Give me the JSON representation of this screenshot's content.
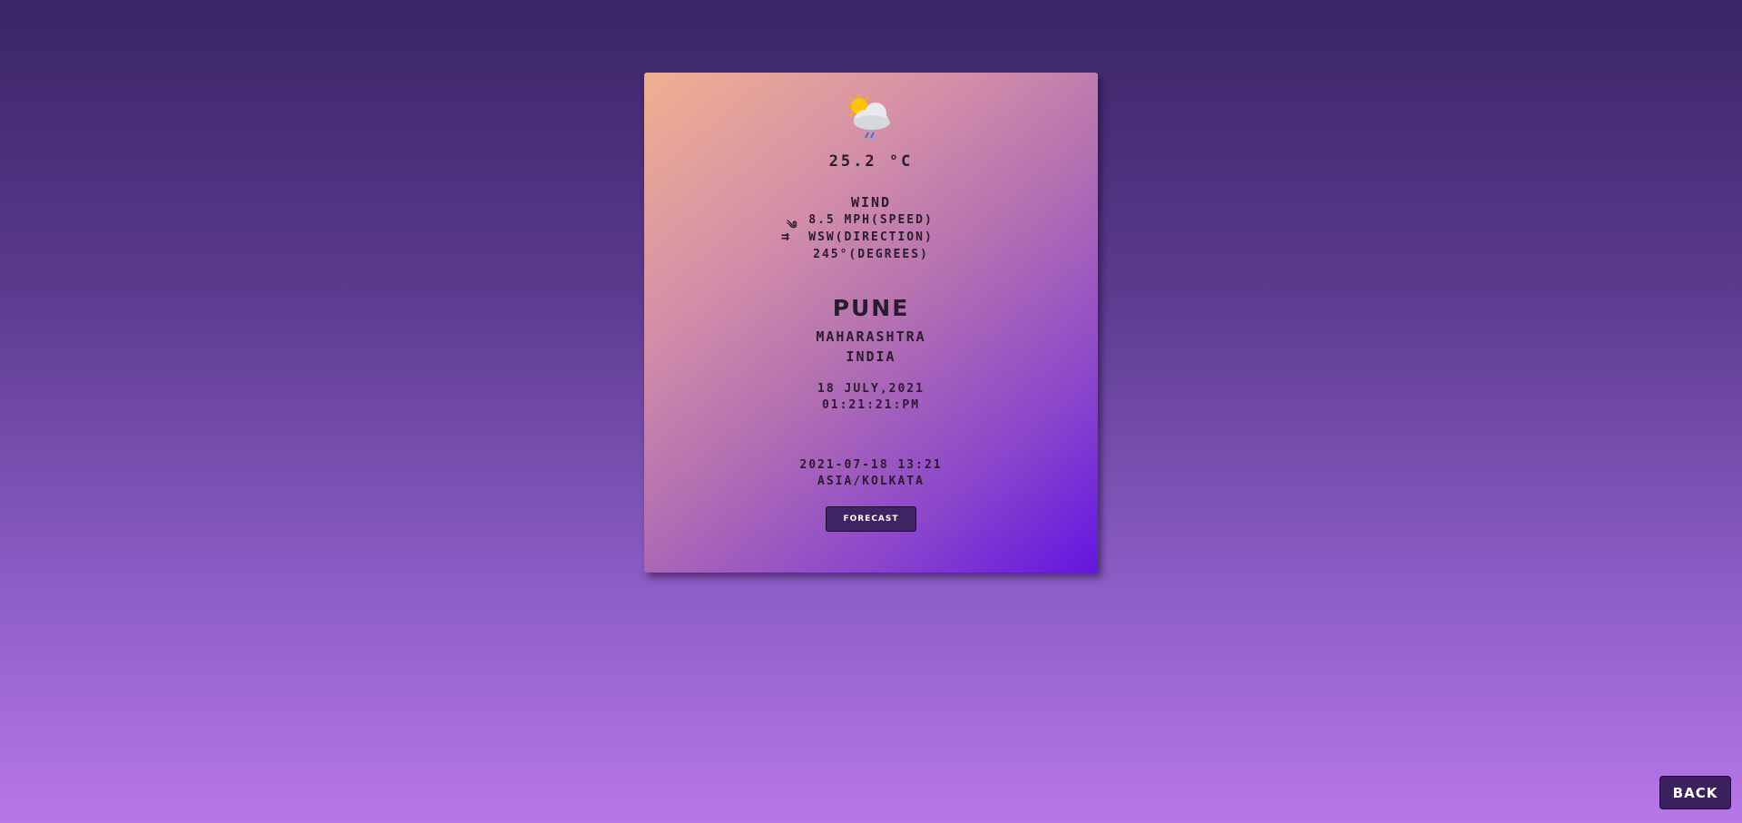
{
  "weather": {
    "icon": "sun-behind-rain-cloud-icon",
    "temperature": "25.2 °C"
  },
  "wind": {
    "title": "WIND",
    "speed": "8.5 MPH(SPEED)",
    "direction": "WSW(DIRECTION)",
    "degrees": "245°(DEGREES)",
    "speed_icon": "wind-icon",
    "direction_icon": "signpost-icon"
  },
  "location": {
    "city": "PUNE",
    "state": "MAHARASHTRA",
    "country": "INDIA"
  },
  "datetime": {
    "date": "18 JULY,2021",
    "time": "01:21:21:PM",
    "local_time": "2021-07-18 13:21",
    "timezone": "ASIA/KOLKATA"
  },
  "buttons": {
    "forecast": "FORECAST",
    "back": "BACK"
  },
  "colors": {
    "button_bg": "#3e2462",
    "card_gradient_start": "#f0b090",
    "card_gradient_end": "#6216e0"
  }
}
